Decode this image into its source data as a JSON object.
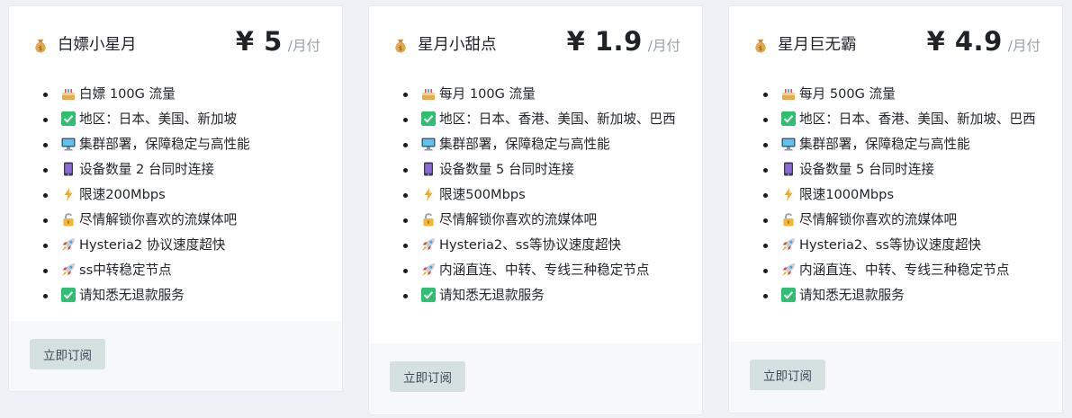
{
  "plans": [
    {
      "name": "白嫖小星月",
      "price": "¥ 5",
      "period": "/月付",
      "features": [
        {
          "icon": "cake-icon",
          "text": "白嫖 100G 流量"
        },
        {
          "icon": "check-icon",
          "text": "地区：日本、美国、新加坡"
        },
        {
          "icon": "computer-icon",
          "text": "集群部署，保障稳定与高性能"
        },
        {
          "icon": "phone-icon",
          "text": "设备数量 2 台同时连接"
        },
        {
          "icon": "lightning-icon",
          "text": "限速200Mbps"
        },
        {
          "icon": "unlock-icon",
          "text": "尽情解锁你喜欢的流媒体吧"
        },
        {
          "icon": "rocket-icon",
          "text": "Hysteria2 协议速度超快"
        },
        {
          "icon": "rocket-icon",
          "text": "ss中转稳定节点"
        },
        {
          "icon": "check-icon",
          "text": "请知悉无退款服务"
        }
      ],
      "button": "立即订阅"
    },
    {
      "name": "星月小甜点",
      "price": "¥ 1.9",
      "period": "/月付",
      "features": [
        {
          "icon": "cake-icon",
          "text": "每月 100G 流量"
        },
        {
          "icon": "check-icon",
          "text": "地区：日本、香港、美国、新加坡、巴西"
        },
        {
          "icon": "computer-icon",
          "text": "集群部署，保障稳定与高性能"
        },
        {
          "icon": "phone-icon",
          "text": "设备数量 5 台同时连接"
        },
        {
          "icon": "lightning-icon",
          "text": "限速500Mbps"
        },
        {
          "icon": "unlock-icon",
          "text": "尽情解锁你喜欢的流媒体吧"
        },
        {
          "icon": "rocket-icon",
          "text": "Hysteria2、ss等协议速度超快"
        },
        {
          "icon": "rocket-icon",
          "text": "内涵直连、中转、专线三种稳定节点"
        },
        {
          "icon": "check-icon",
          "text": "请知悉无退款服务"
        }
      ],
      "button": "立即订阅"
    },
    {
      "name": "星月巨无霸",
      "price": "¥ 4.9",
      "period": "/月付",
      "features": [
        {
          "icon": "cake-icon",
          "text": "每月 500G 流量"
        },
        {
          "icon": "check-icon",
          "text": "地区：日本、香港、美国、新加坡、巴西"
        },
        {
          "icon": "computer-icon",
          "text": "集群部署，保障稳定与高性能"
        },
        {
          "icon": "phone-icon",
          "text": "设备数量 5 台同时连接"
        },
        {
          "icon": "lightning-icon",
          "text": "限速1000Mbps"
        },
        {
          "icon": "unlock-icon",
          "text": "尽情解锁你喜欢的流媒体吧"
        },
        {
          "icon": "rocket-icon",
          "text": "Hysteria2、ss等协议速度超快"
        },
        {
          "icon": "rocket-icon",
          "text": "内涵直连、中转、专线三种稳定节点"
        },
        {
          "icon": "check-icon",
          "text": "请知悉无退款服务"
        }
      ],
      "button": "立即订阅"
    }
  ]
}
